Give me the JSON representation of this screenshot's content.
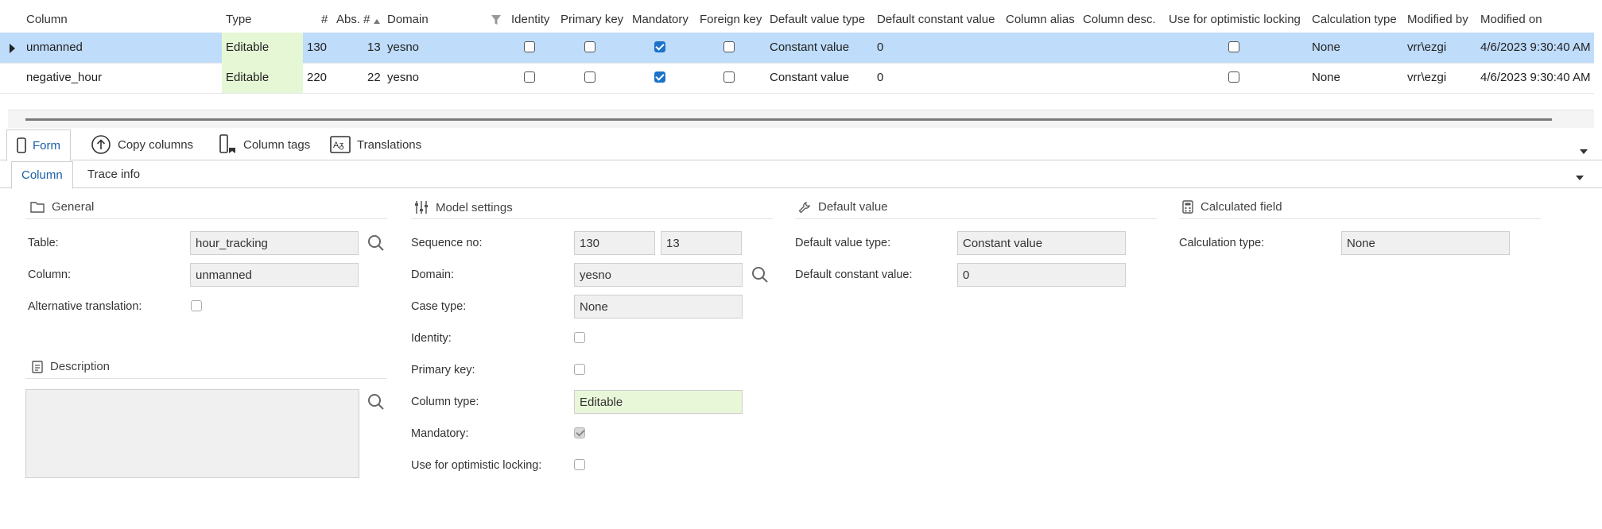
{
  "grid": {
    "columns": [
      "Column",
      "Type",
      "#",
      "Abs. #",
      "Domain",
      "Identity",
      "Primary key",
      "Mandatory",
      "Foreign key",
      "Default value type",
      "Default constant value",
      "Column alias",
      "Column desc.",
      "Use for optimistic locking",
      "Calculation type",
      "Modified by",
      "Modified on"
    ],
    "rows": [
      {
        "column": "unmanned",
        "type": "Editable",
        "seq": "130",
        "abs": "13",
        "domain": "yesno",
        "identity": false,
        "primary_key": false,
        "mandatory": true,
        "foreign_key": false,
        "default_value_type": "Constant value",
        "default_constant_value": "0",
        "optimistic_locking": false,
        "calculation_type": "None",
        "modified_by": "vrr\\ezgi",
        "modified_on": "4/6/2023 9:30:40 AM",
        "selected": true
      },
      {
        "column": "negative_hour",
        "type": "Editable",
        "seq": "220",
        "abs": "22",
        "domain": "yesno",
        "identity": false,
        "primary_key": false,
        "mandatory": true,
        "foreign_key": false,
        "default_value_type": "Constant value",
        "default_constant_value": "0",
        "optimistic_locking": false,
        "calculation_type": "None",
        "modified_by": "vrr\\ezgi",
        "modified_on": "4/6/2023 9:30:40 AM",
        "selected": false
      }
    ]
  },
  "tabs": [
    "Form",
    "Copy columns",
    "Column tags",
    "Translations"
  ],
  "subtabs": [
    "Column",
    "Trace info"
  ],
  "general": {
    "title": "General",
    "table_label": "Table:",
    "table_value": "hour_tracking",
    "column_label": "Column:",
    "column_value": "unmanned",
    "alt_translation_label": "Alternative translation:"
  },
  "description": {
    "title": "Description"
  },
  "model": {
    "title": "Model settings",
    "sequence_label": "Sequence no:",
    "sequence_value": "130",
    "abs_value": "13",
    "domain_label": "Domain:",
    "domain_value": "yesno",
    "case_label": "Case type:",
    "case_value": "None",
    "identity_label": "Identity:",
    "primary_label": "Primary key:",
    "column_type_label": "Column type:",
    "column_type_value": "Editable",
    "mandatory_label": "Mandatory:",
    "optimistic_label": "Use for optimistic locking:"
  },
  "default_value": {
    "title": "Default value",
    "type_label": "Default value type:",
    "type_value": "Constant value",
    "constant_label": "Default constant value:",
    "constant_value": "0"
  },
  "calculated": {
    "title": "Calculated field",
    "calc_label": "Calculation type:",
    "calc_value": "None"
  },
  "colors": {
    "selected_row": "#bfdcfb",
    "editable_bg": "#e6f7d6",
    "accent": "#1a5fa8",
    "checkbox_checked": "#1a73c9"
  }
}
